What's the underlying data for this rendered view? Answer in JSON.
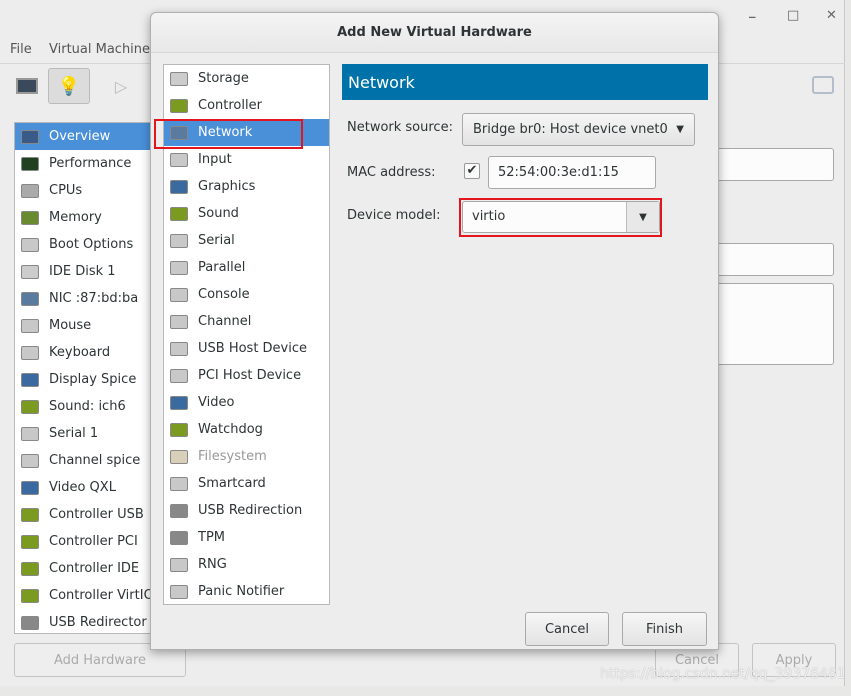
{
  "background_window": {
    "menu": [
      "File",
      "Virtual Machine"
    ],
    "window_controls": [
      "minimize",
      "maximize",
      "close"
    ],
    "sidebar": [
      {
        "label": "Overview",
        "icon": "monitor-icon",
        "selected": true
      },
      {
        "label": "Performance",
        "icon": "performance-icon"
      },
      {
        "label": "CPUs",
        "icon": "cpu-icon"
      },
      {
        "label": "Memory",
        "icon": "memory-icon"
      },
      {
        "label": "Boot Options",
        "icon": "gear-icon"
      },
      {
        "label": "IDE Disk 1",
        "icon": "disk-icon"
      },
      {
        "label": "NIC :87:bd:ba",
        "icon": "network-icon"
      },
      {
        "label": "Mouse",
        "icon": "mouse-icon"
      },
      {
        "label": "Keyboard",
        "icon": "keyboard-icon"
      },
      {
        "label": "Display Spice",
        "icon": "display-icon"
      },
      {
        "label": "Sound: ich6",
        "icon": "sound-icon"
      },
      {
        "label": "Serial 1",
        "icon": "serial-icon"
      },
      {
        "label": "Channel spice",
        "icon": "channel-icon"
      },
      {
        "label": "Video QXL",
        "icon": "video-icon"
      },
      {
        "label": "Controller USB",
        "icon": "controller-icon"
      },
      {
        "label": "Controller PCI",
        "icon": "controller-icon"
      },
      {
        "label": "Controller IDE",
        "icon": "controller-icon"
      },
      {
        "label": "Controller VirtIO",
        "icon": "controller-icon"
      },
      {
        "label": "USB Redirector",
        "icon": "usb-icon"
      }
    ],
    "add_hardware": "Add Hardware",
    "cancel": "Cancel",
    "apply": "Apply"
  },
  "dialog": {
    "title": "Add New Virtual Hardware",
    "hardware_types": [
      {
        "label": "Storage",
        "icon": "storage-icon"
      },
      {
        "label": "Controller",
        "icon": "controller-icon"
      },
      {
        "label": "Network",
        "icon": "network-icon",
        "selected": true
      },
      {
        "label": "Input",
        "icon": "mouse-icon"
      },
      {
        "label": "Graphics",
        "icon": "display-icon"
      },
      {
        "label": "Sound",
        "icon": "sound-icon"
      },
      {
        "label": "Serial",
        "icon": "serial-icon"
      },
      {
        "label": "Parallel",
        "icon": "parallel-icon"
      },
      {
        "label": "Console",
        "icon": "console-icon"
      },
      {
        "label": "Channel",
        "icon": "channel-icon"
      },
      {
        "label": "USB Host Device",
        "icon": "usb-device-icon"
      },
      {
        "label": "PCI Host Device",
        "icon": "pci-device-icon"
      },
      {
        "label": "Video",
        "icon": "video-icon"
      },
      {
        "label": "Watchdog",
        "icon": "watchdog-icon"
      },
      {
        "label": "Filesystem",
        "icon": "folder-icon",
        "disabled": true
      },
      {
        "label": "Smartcard",
        "icon": "smartcard-icon"
      },
      {
        "label": "USB Redirection",
        "icon": "usb-icon"
      },
      {
        "label": "TPM",
        "icon": "tpm-icon"
      },
      {
        "label": "RNG",
        "icon": "rng-icon"
      },
      {
        "label": "Panic Notifier",
        "icon": "panic-icon"
      }
    ],
    "panel_title": "Network",
    "network_source_label": "Network source:",
    "network_source_value": "Bridge br0: Host device vnet0",
    "mac_label": "MAC address:",
    "mac_checked": true,
    "mac_value": "52:54:00:3e:d1:15",
    "device_model_label": "Device model:",
    "device_model_value": "virtio",
    "cancel": "Cancel",
    "finish": "Finish"
  },
  "watermark": "https://blog.csdn.net/qq_39376481",
  "colors": {
    "header": "#0072aa",
    "selection": "#4a90d9",
    "highlight": "#e3161f"
  }
}
